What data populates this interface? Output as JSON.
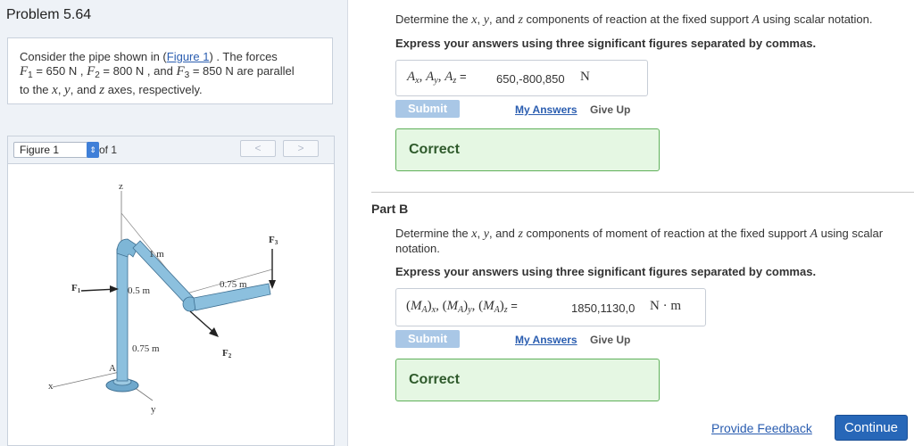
{
  "problem": {
    "title": "Problem 5.64",
    "intro_text": "Consider the pipe shown in (",
    "figure_link": "Figure 1",
    "after_link": ") . The forces",
    "f1": "F",
    "f1_sub": "1",
    "f1_val": " = 650 N , ",
    "f2": "F",
    "f2_sub": "2",
    "f2_val": " = 800 N , and ",
    "f3": "F",
    "f3_sub": "3",
    "f3_val": " = 850 N are parallel",
    "line3_a": "to the ",
    "x": "x",
    "comma1": ", ",
    "y": "y",
    "and": ", and ",
    "z": "z",
    "line3_b": " axes, respectively."
  },
  "figure": {
    "select_value": "Figure 1",
    "of_text": "of 1",
    "prev": "<",
    "next": ">",
    "labels": {
      "z": "z",
      "x": "x",
      "y": "y",
      "A": "A",
      "F1": "F",
      "F1_sub": "1",
      "F2": "F",
      "F2_sub": "2",
      "F3": "F",
      "F3_sub": "3",
      "dim_1m": "1 m",
      "dim_05m": "0.5 m",
      "dim_075m_a": "0.75 m",
      "dim_075m_b": "0.75 m"
    }
  },
  "part_a": {
    "question_1": "Determine the ",
    "question_x": "x",
    "question_2": ", ",
    "question_y": "y",
    "question_3": ", and ",
    "question_z": "z",
    "question_4": " components of reaction at the fixed support ",
    "question_A": "A",
    "question_5": " using scalar notation.",
    "instruction": "Express your answers using three significant figures separated by commas.",
    "label_A": "A",
    "label_x": "x",
    "label_y": "y",
    "label_z": "z",
    "label_sep": ", ",
    "label_eq": " =",
    "value": "650,-800,850",
    "unit": "N",
    "submit": "Submit",
    "my_answers": "My Answers",
    "give_up": "Give Up",
    "result": "Correct"
  },
  "part_b": {
    "title": "Part B",
    "question_1": "Determine the ",
    "question_x": "x",
    "question_2": ", ",
    "question_y": "y",
    "question_3": ", and ",
    "question_z": "z",
    "question_4": " components of moment of reaction at the fixed support ",
    "question_A": "A",
    "question_5": " using scalar",
    "question_6": "notation.",
    "instruction": "Express your answers using three significant figures separated by commas.",
    "label_M": "M",
    "label_A": "A",
    "label_x": "x",
    "label_y": "y",
    "label_z": "z",
    "label_eq": " =",
    "value": "1850,1130,0",
    "unit": "N · m",
    "submit": "Submit",
    "my_answers": "My Answers",
    "give_up": "Give Up",
    "result": "Correct"
  },
  "footer": {
    "feedback": "Provide Feedback",
    "continue": "Continue"
  },
  "colors": {
    "link": "#2a5db0",
    "submit_disabled": "#a9c7e6",
    "correct_bg": "#e5f7e3",
    "correct_border": "#5fb05a",
    "continue_bg": "#2767b8",
    "pipe": "#7eb6d6"
  }
}
